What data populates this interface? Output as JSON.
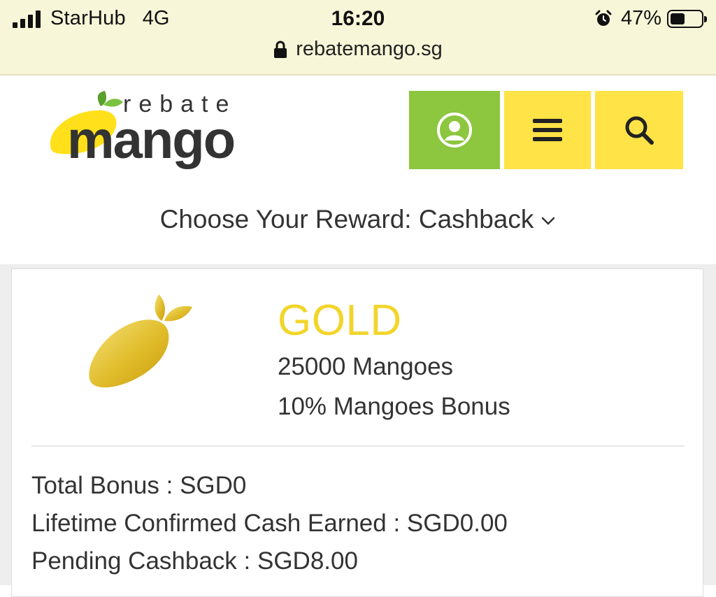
{
  "status_bar": {
    "carrier": "StarHub",
    "network": "4G",
    "time": "16:20",
    "battery": "47%",
    "battery_level": 0.47,
    "url": "rebatemango.sg"
  },
  "header": {
    "logo_top": "rebate",
    "logo_bottom": "mango",
    "icons": [
      "user-icon",
      "menu-icon",
      "search-icon"
    ],
    "colors": {
      "user_button": "#8dc63f",
      "menu_button": "#ffe347",
      "search_button": "#ffe347",
      "gold": "#f2d52b"
    }
  },
  "reward": {
    "label": "Choose Your Reward: Cashback"
  },
  "tier": {
    "name": "GOLD",
    "mangoes": "25000 Mangoes",
    "bonus": "10% Mangoes Bonus"
  },
  "summary": {
    "total_bonus": "Total Bonus : SGD0",
    "lifetime": "Lifetime Confirmed Cash Earned : SGD0.00",
    "pending": "Pending Cashback : SGD8.00"
  }
}
